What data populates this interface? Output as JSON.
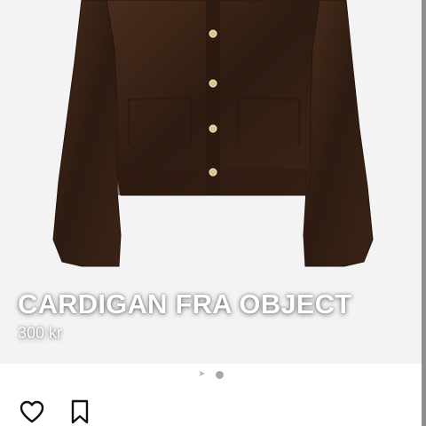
{
  "listing": {
    "title": "CARDIGAN FRA OBJECT",
    "price": "300 kr"
  },
  "image_pager": {
    "current_index": 2,
    "total": 2
  },
  "actions": {
    "like_icon": "heart-outline-icon",
    "save_icon": "bookmark-outline-icon"
  },
  "colors": {
    "background": "#f3f3f3",
    "cardigan": "#3a2416",
    "text": "#ffffff",
    "icon": "#111111",
    "pager": "#a8a8a8"
  }
}
